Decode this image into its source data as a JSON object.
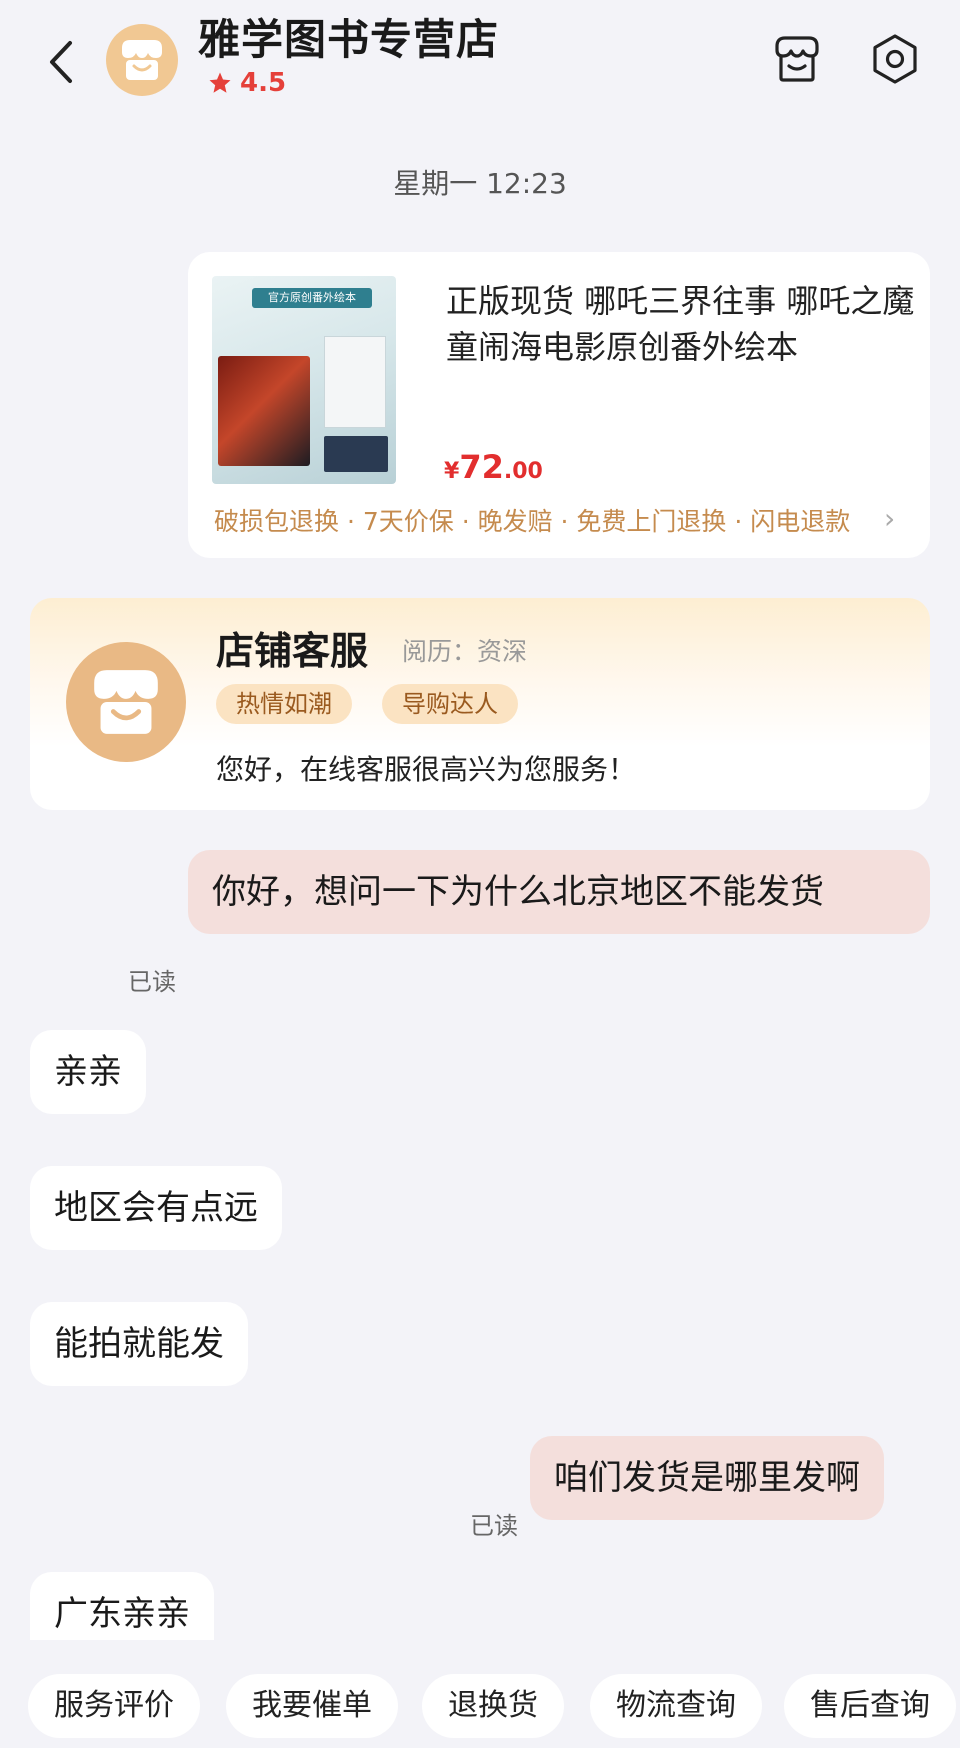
{
  "header": {
    "shop_name": "雅学图书专营店",
    "rating": "4.5",
    "icons": [
      "back-chevron-icon",
      "shop-avatar-icon",
      "star-icon",
      "store-icon",
      "settings-icon"
    ]
  },
  "timestamp": "星期一 12:23",
  "product": {
    "title": "正版现货 哪吒三界往事 哪吒之魔童闹海电影原创番外绘本",
    "thumb_banner": "官方原创番外绘本",
    "price_symbol": "¥",
    "price_int": "72",
    "price_dec": ".00",
    "tags": "破损包退换 · 7天价保 · 晚发赔 · 免费上门退换 · 闪电退款"
  },
  "service": {
    "name": "店铺客服",
    "experience": "阅历：资深",
    "badges": [
      "热情如潮",
      "导购达人"
    ],
    "greeting": "您好，在线客服很高兴为您服务！"
  },
  "messages": [
    {
      "side": "right",
      "text": "你好，想问一下为什么北京地区不能发货",
      "status": "已读"
    },
    {
      "side": "left",
      "text": "亲亲"
    },
    {
      "side": "left",
      "text": "地区会有点远"
    },
    {
      "side": "left",
      "text": "能拍就能发"
    },
    {
      "side": "right",
      "text": "咱们发货是哪里发啊",
      "status": "已读"
    },
    {
      "side": "left",
      "text": "广东亲亲"
    }
  ],
  "quick_replies": [
    "服务评价",
    "我要催单",
    "退换货",
    "物流查询",
    "售后查询"
  ],
  "colors": {
    "background": "#f3f3f8",
    "accent_price": "#e22e2e",
    "rating_red": "#e5403a",
    "tag_gold": "#c58b4e",
    "sent_bubble": "#f4dfdc",
    "avatar_orange": "#f1c893"
  }
}
